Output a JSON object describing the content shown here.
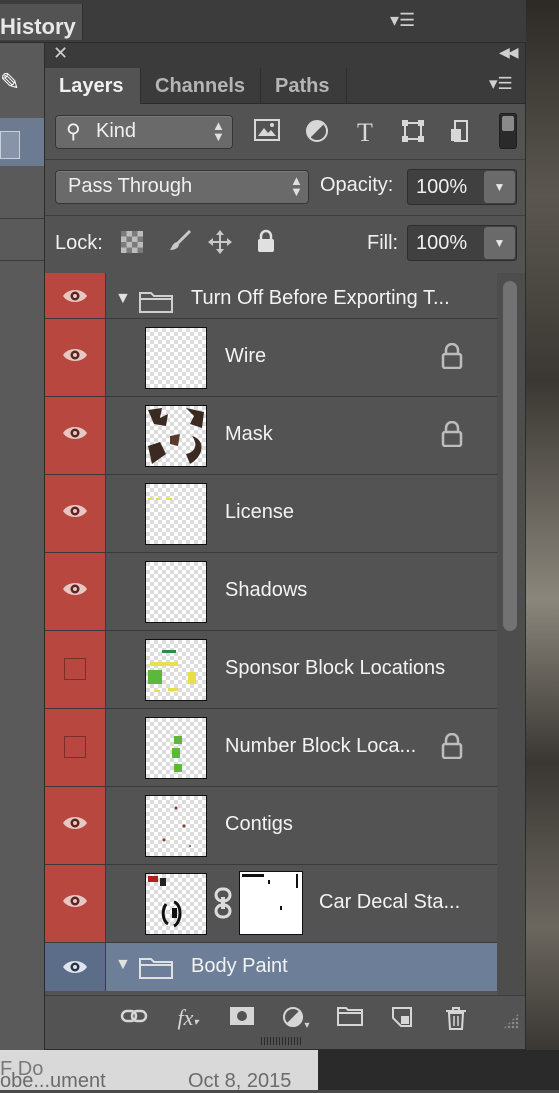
{
  "background": {
    "history_tab_label": "History",
    "doc_text_1": "F Do",
    "doc_text_2": "obe...ument",
    "doc_date": "Oct 8, 2015"
  },
  "panel": {
    "tabs": [
      {
        "label": "Layers",
        "active": true
      },
      {
        "label": "Channels",
        "active": false
      },
      {
        "label": "Paths",
        "active": false
      }
    ],
    "filter": {
      "kind_label": "Kind",
      "filter_icons": [
        "pixel-filter-icon",
        "adjustment-filter-icon",
        "type-filter-icon",
        "shape-filter-icon",
        "smart-object-filter-icon"
      ]
    },
    "blend_mode": "Pass Through",
    "opacity_label": "Opacity:",
    "opacity_value": "100%",
    "lock_label": "Lock:",
    "fill_label": "Fill:",
    "fill_value": "100%"
  },
  "layers": {
    "group": {
      "name": "Turn Off Before Exporting T...",
      "visible": true,
      "expanded": true
    },
    "items": [
      {
        "name": "Wire",
        "visible": true,
        "locked": true
      },
      {
        "name": "Mask",
        "visible": true,
        "locked": true
      },
      {
        "name": "License",
        "visible": true,
        "locked": false
      },
      {
        "name": "Shadows",
        "visible": true,
        "locked": false
      },
      {
        "name": "Sponsor Block Locations",
        "visible": false,
        "locked": false
      },
      {
        "name": "Number Block Loca...",
        "visible": false,
        "locked": true
      },
      {
        "name": "Contigs",
        "visible": true,
        "locked": false
      },
      {
        "name": "Car Decal Sta...",
        "visible": true,
        "locked": false
      }
    ],
    "body_paint": {
      "name": "Body Paint",
      "visible": true,
      "expanded": true,
      "selected": true
    }
  },
  "colors": {
    "visibility_red": "#b84740",
    "selected_blue": "#6d7e98",
    "panel_gray": "#535353"
  }
}
